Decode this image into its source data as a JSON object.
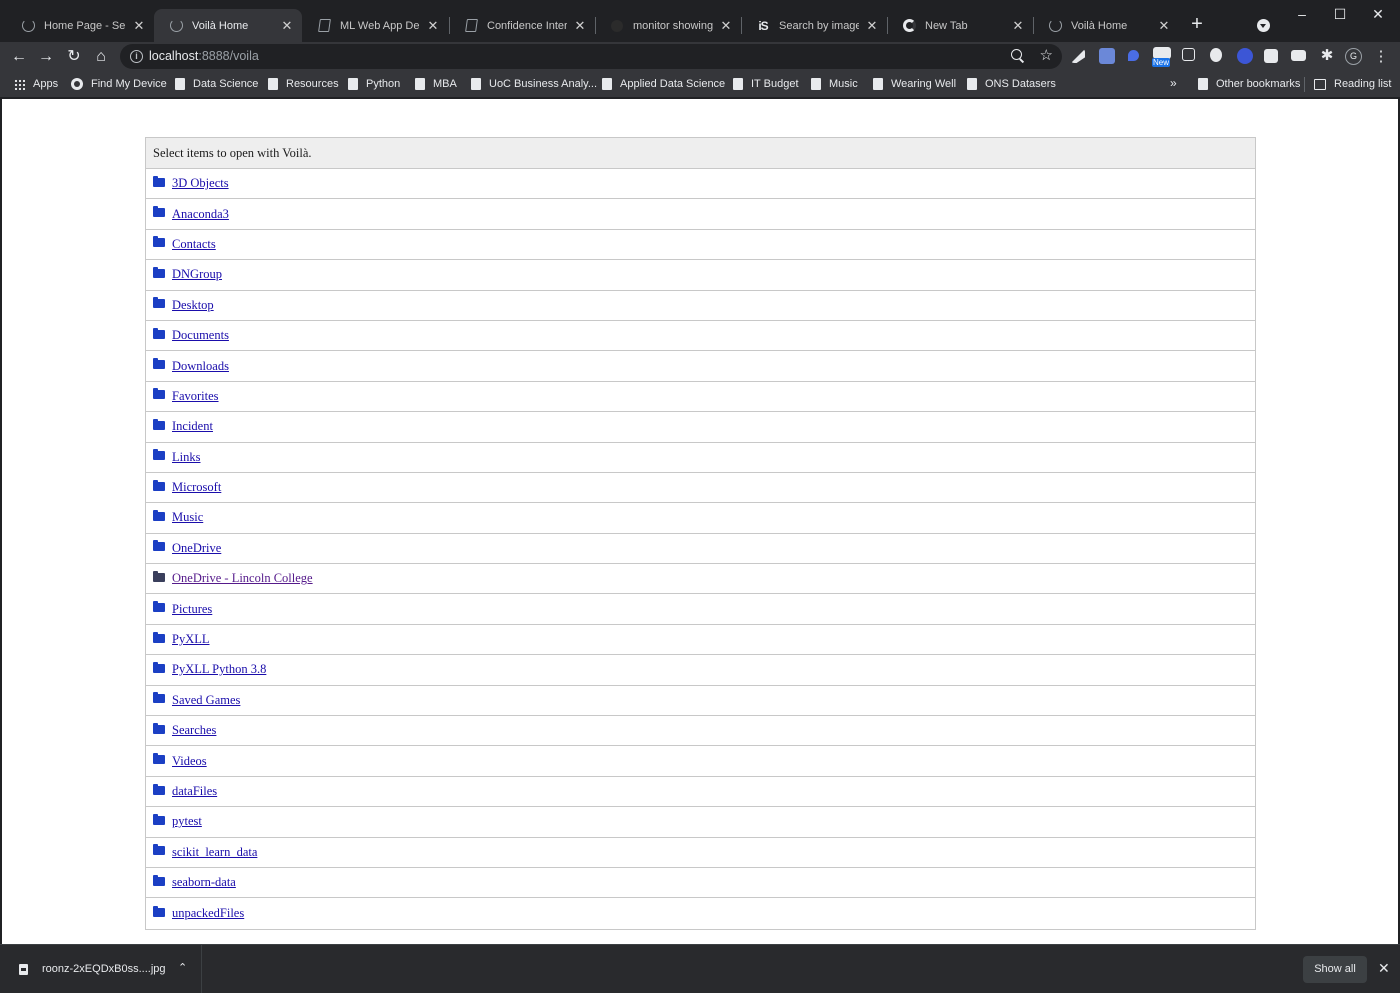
{
  "tabs": [
    {
      "title": "Home Page - Select",
      "icon": "spinner-icon",
      "active": false
    },
    {
      "title": "Voilà Home",
      "icon": "spinner-icon",
      "active": true
    },
    {
      "title": "ML Web App Deplo",
      "icon": "document-icon",
      "active": false
    },
    {
      "title": "Confidence Interval",
      "icon": "document-icon",
      "active": false
    },
    {
      "title": "monitor showing C",
      "icon": "favicon-dark-icon",
      "active": false
    },
    {
      "title": "Search by image - t",
      "icon": "is-logo-icon",
      "active": false
    },
    {
      "title": "New Tab",
      "icon": "google-icon",
      "active": false
    },
    {
      "title": "Voilà Home",
      "icon": "spinner-icon",
      "active": false
    }
  ],
  "toolbar": {
    "url_host": "localhost",
    "url_rest": ":8888/voila"
  },
  "bookmarks": {
    "items": [
      {
        "label": "Apps"
      },
      {
        "label": "Find My Device"
      },
      {
        "label": "Data Science"
      },
      {
        "label": "Resources"
      },
      {
        "label": "Python"
      },
      {
        "label": "MBA"
      },
      {
        "label": "UoC Business Analy..."
      },
      {
        "label": "Applied Data Science"
      },
      {
        "label": "IT Budget"
      },
      {
        "label": "Music"
      },
      {
        "label": "Wearing Well"
      },
      {
        "label": "ONS Datasers"
      }
    ],
    "overflow": "»",
    "other": "Other bookmarks",
    "reading_list": "Reading list"
  },
  "extensions": {
    "new_badge": "New",
    "profile_initial": "G"
  },
  "page": {
    "header": "Select items to open with Voilà.",
    "folders": [
      {
        "name": "3D Objects",
        "visited": false
      },
      {
        "name": "Anaconda3",
        "visited": false
      },
      {
        "name": "Contacts",
        "visited": false
      },
      {
        "name": "DNGroup",
        "visited": false
      },
      {
        "name": "Desktop",
        "visited": false
      },
      {
        "name": "Documents",
        "visited": false
      },
      {
        "name": "Downloads",
        "visited": false
      },
      {
        "name": "Favorites",
        "visited": false
      },
      {
        "name": "Incident",
        "visited": false
      },
      {
        "name": "Links",
        "visited": false
      },
      {
        "name": "Microsoft",
        "visited": false
      },
      {
        "name": "Music",
        "visited": false
      },
      {
        "name": "OneDrive",
        "visited": false
      },
      {
        "name": "OneDrive - Lincoln College",
        "visited": true
      },
      {
        "name": "Pictures",
        "visited": false
      },
      {
        "name": "PyXLL",
        "visited": false
      },
      {
        "name": "PyXLL Python 3.8",
        "visited": false
      },
      {
        "name": "Saved Games",
        "visited": false
      },
      {
        "name": "Searches",
        "visited": false
      },
      {
        "name": "Videos",
        "visited": false
      },
      {
        "name": "dataFiles",
        "visited": false
      },
      {
        "name": "pytest",
        "visited": false
      },
      {
        "name": "scikit_learn_data",
        "visited": false
      },
      {
        "name": "seaborn-data",
        "visited": false
      },
      {
        "name": "unpackedFiles",
        "visited": false
      }
    ]
  },
  "downloads": {
    "filename": "roonz-2xEQDxB0ss....jpg",
    "show_all": "Show all"
  },
  "colors": {
    "link": "#1a0dab",
    "visited_link": "#551a8b",
    "folder_icon": "#1b3fc4",
    "chrome_dark": "#202124",
    "chrome_toolbar": "#35363a"
  }
}
